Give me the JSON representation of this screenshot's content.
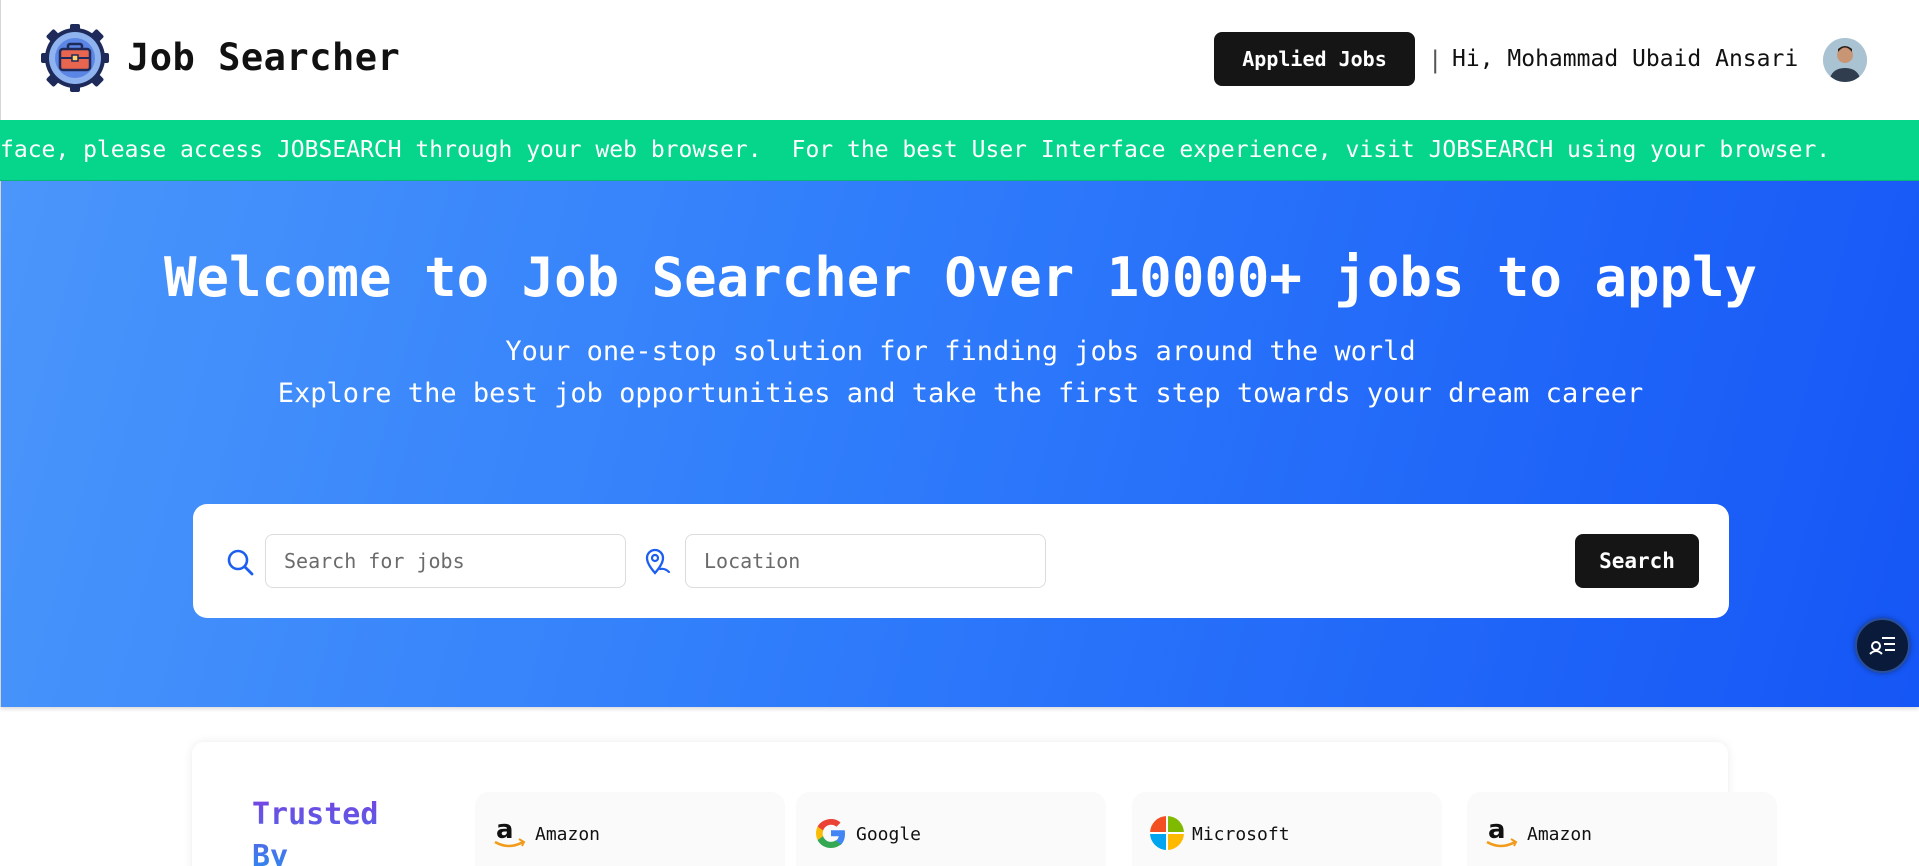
{
  "header": {
    "brand": "Job Searcher",
    "applied_jobs_label": "Applied Jobs",
    "separator": "|",
    "greeting": "Hi, Mohammad Ubaid Ansari"
  },
  "banner": {
    "message_partial": "face, please access JOBSEARCH through your web browser.",
    "message_full": "For the best User Interface experience, visit JOBSEARCH using your browser.",
    "bg_color": "#06d58c"
  },
  "hero": {
    "title": "Welcome to Job Searcher Over 10000+ jobs to apply",
    "subtitle_1": "Your one-stop solution for finding jobs around the world",
    "subtitle_2": "Explore the best job opportunities and take the first step towards your dream career"
  },
  "search": {
    "job_placeholder": "Search for jobs",
    "job_value": "",
    "location_placeholder": "Location",
    "location_value": "",
    "button_label": "Search",
    "search_icon": "search-icon",
    "location_icon": "location-pin-icon"
  },
  "trusted": {
    "title_line1": "Trusted",
    "title_line2": "By",
    "companies": [
      {
        "name": "Amazon",
        "icon": "amazon-logo"
      },
      {
        "name": "Google",
        "icon": "google-logo"
      },
      {
        "name": "Microsoft",
        "icon": "microsoft-logo"
      },
      {
        "name": "Amazon",
        "icon": "amazon-logo"
      }
    ]
  },
  "colors": {
    "accent_dark": "#151515",
    "hero_gradient_start": "#4a96fb",
    "hero_gradient_end": "#1556f6"
  }
}
